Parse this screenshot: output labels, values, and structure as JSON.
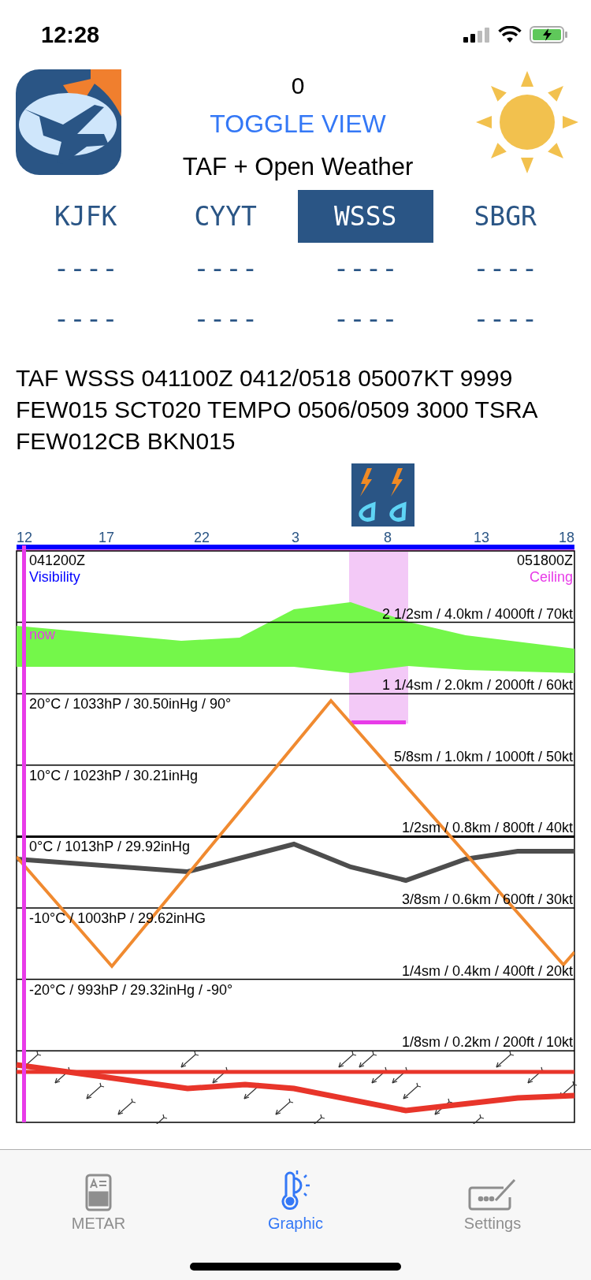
{
  "status_bar": {
    "time": "12:28"
  },
  "header": {
    "counter": "0",
    "toggle_button": "TOGGLE VIEW",
    "source": "TAF + Open Weather"
  },
  "stations": [
    {
      "code": "KJFK",
      "selected": false,
      "line_1": "----",
      "line_2": "----"
    },
    {
      "code": "CYYT",
      "selected": false,
      "line_1": "----",
      "line_2": "----"
    },
    {
      "code": "WSSS",
      "selected": true,
      "line_1": "----",
      "line_2": "----"
    },
    {
      "code": "SBGR",
      "selected": false,
      "line_1": "----",
      "line_2": "----"
    }
  ],
  "taf": "TAF WSSS 041100Z 0412/0518 05007KT 9999 FEW015 SCT020 TEMPO 0506/0509 3000 TSRA FEW012CB BKN015",
  "graph": {
    "hours": [
      "12",
      "17",
      "22",
      "3",
      "8",
      "13",
      "18"
    ],
    "start_time": "041200Z",
    "end_time": "051800Z",
    "left_title": "Visibility",
    "right_title": "Ceiling",
    "now_label": "now",
    "rows": [
      {
        "right": "2 1/2sm / 4.0km / 4000ft / 70kt"
      },
      {
        "right": "1 1/4sm / 2.0km / 2000ft / 60kt"
      },
      {
        "left": "20°C / 1033hP / 30.50inHg / 90°",
        "right": "5/8sm / 1.0km / 1000ft / 50kt"
      },
      {
        "left": "10°C / 1023hP / 30.21inHg",
        "right": "1/2sm / 0.8km / 800ft / 40kt"
      },
      {
        "left": "0°C / 1013hP / 29.92inHg",
        "right": "3/8sm / 0.6km / 600ft / 30kt"
      },
      {
        "left": "-10°C / 1003hP / 29.62inHG",
        "right": "1/4sm / 0.4km / 400ft / 20kt"
      },
      {
        "left": "-20°C / 993hP / 29.32inHg / -90°",
        "right": "1/8sm / 0.2km / 200ft / 10kt"
      }
    ]
  },
  "tab_bar": [
    {
      "label": "METAR",
      "kind": "document",
      "selected": false
    },
    {
      "label": "Graphic",
      "kind": "thermometer",
      "selected": true
    },
    {
      "label": "Settings",
      "kind": "keyboard",
      "selected": false
    }
  ]
}
